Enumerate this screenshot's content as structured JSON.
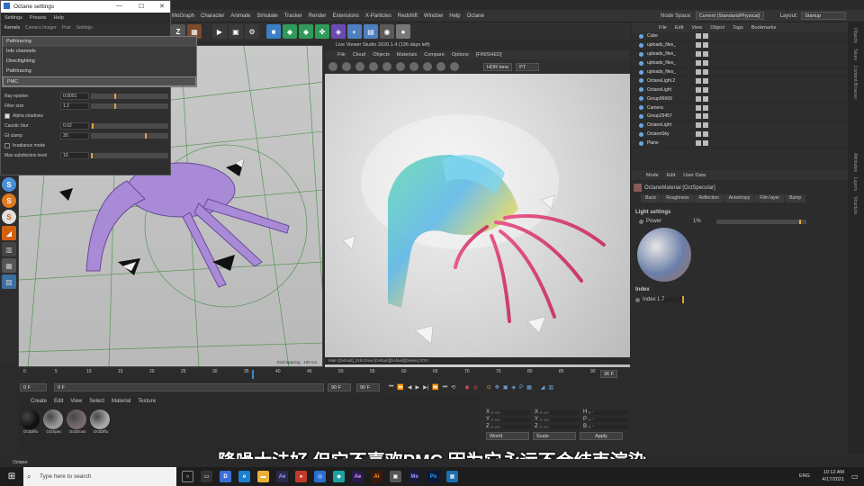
{
  "octane_window": {
    "title": "Octane settings",
    "menu": [
      "Settings",
      "Presets",
      "Help"
    ],
    "kernel_tabs": [
      "Kernels",
      "Camera Imager",
      "Post",
      "Settings"
    ],
    "kernel_options": [
      "Pathtracing",
      "Info channels",
      "Directlighting",
      "Pathtracing",
      "PMC"
    ],
    "params": [
      {
        "label": "Ray epsilon",
        "value": "0.0001",
        "level": 0.3
      },
      {
        "label": "Filter size",
        "value": "1.2",
        "level": 0.3
      },
      {
        "label": "Alpha shadows",
        "value": "",
        "level": null
      },
      {
        "label": "Caustic blur",
        "value": "0.02",
        "level": 0.02
      },
      {
        "label": "GI clamp",
        "value": "30.",
        "level": 0.7
      },
      {
        "label": "Irradiance mode",
        "value": "",
        "level": null
      },
      {
        "label": "Max subdivision level",
        "value": "10.",
        "level": 0
      }
    ]
  },
  "main_menu": [
    "MoGraph",
    "Character",
    "Animate",
    "Simulate",
    "Tracker",
    "Render",
    "Extensions",
    "X-Particles",
    "Redshift",
    "Window",
    "Help",
    "Octane"
  ],
  "node_space": {
    "label": "Node Space:",
    "value": "Current (Standard/Physical)"
  },
  "layout": {
    "label": "Layout:",
    "value": "Startup"
  },
  "live_viewer": {
    "title": "Live Viewer Studio 2020.1.4 (136 days left)",
    "menu": [
      "File",
      "Cloud",
      "Objects",
      "Materials",
      "Compare",
      "Options"
    ],
    "status_tag": "[FINISHED]",
    "tonemap": "HDR tone",
    "channel": "PT",
    "status_bar": "Main  [Default]_Edit  Draw  [Default][Default][Delete]  ZOO"
  },
  "viewport": {
    "grid_spacing": "Grid Spacing : 100 cm"
  },
  "object_manager": {
    "menu": [
      "File",
      "Edit",
      "View",
      "Object",
      "Tags",
      "Bookmarks"
    ],
    "objects": [
      "Cube",
      "uploads_files_",
      "uploads_files_",
      "uploads_files_",
      "uploads_files_",
      "OctaneLight.2",
      "OctaneLight",
      "Group96669",
      "Camera",
      "Group29457",
      "OctaneLight",
      "OctaneSky",
      "Plane"
    ]
  },
  "attributes": {
    "menu": [
      "Mode",
      "Edit",
      "User Data"
    ],
    "material": "OctaneMaterial [OctSpecular]",
    "tabs": [
      "Basic",
      "Roughness",
      "Reflection",
      "Anisotropy",
      "Film layer",
      "Bump"
    ],
    "section": "Light settings",
    "power_label": "Power",
    "power_value": "1%",
    "index_section": "Index",
    "index_label": "Index",
    "index_value": "1.7"
  },
  "right_tabs": [
    "Objects",
    "Takes",
    "Content Browser",
    "Attributes",
    "Layers",
    "Structure"
  ],
  "timeline": {
    "ticks": [
      "0",
      "5",
      "10",
      "15",
      "20",
      "25",
      "30",
      "35",
      "40",
      "45",
      "50",
      "55",
      "60",
      "65",
      "70",
      "75",
      "80",
      "85",
      "90"
    ],
    "current_frame": "36 F",
    "start_field": "0 F",
    "start_field2": "0 F",
    "end_field": "90 F",
    "end_field2": "90 F"
  },
  "material_panel": {
    "menu": [
      "Create",
      "Edit",
      "View",
      "Select",
      "Material",
      "Texture"
    ],
    "materials": [
      {
        "name": "OctDiffu",
        "color": "#111111"
      },
      {
        "name": "OctSpec",
        "color": "#9a9a9a"
      },
      {
        "name": "OctGloss",
        "color": "#7a6a70"
      },
      {
        "name": "OctDiffu",
        "color": "#a8a8a8"
      }
    ]
  },
  "coords": {
    "rows": [
      [
        "X",
        "0 cm",
        "X",
        "0 cm",
        "H",
        "0 °"
      ],
      [
        "Y",
        "0 cm",
        "Y",
        "0 cm",
        "P",
        "0 °"
      ],
      [
        "Z",
        "0 cm",
        "Z",
        "0 cm",
        "B",
        "0 °"
      ]
    ],
    "mode1": "World",
    "mode2": "Scale",
    "apply": "Apply"
  },
  "subtitle": "降噪大法好 但它不喜欢PMC 因为它永远不会结束渲染",
  "status_line": "Octane:",
  "taskbar": {
    "search_placeholder": "Type here to search",
    "lang": "ENG",
    "time": "10:12 AM",
    "date": "4/17/2021"
  },
  "colors": {
    "accent_orange": "#e0a43a",
    "viewport_grid": "#3c8c3c",
    "taskbar": "#1d1d1d"
  }
}
